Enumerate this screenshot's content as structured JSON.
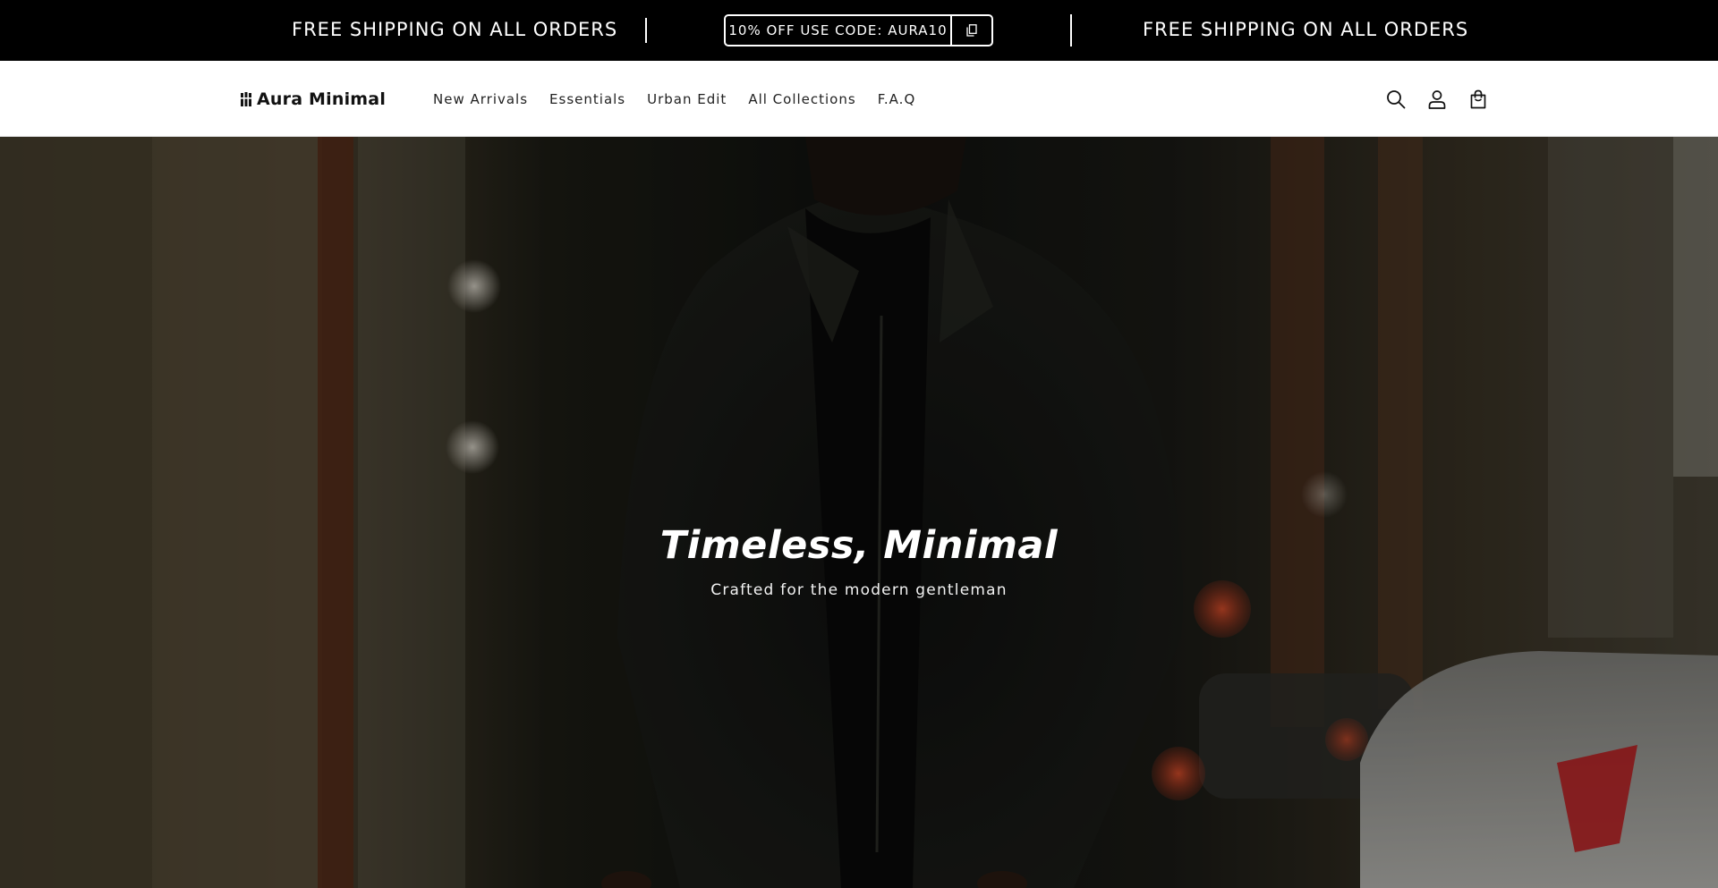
{
  "announcement": {
    "left_message": "FREE SHIPPING ON ALL ORDERS",
    "promo_code_text": "10% OFF USE CODE: AURA10",
    "right_message": "FREE SHIPPING ON ALL ORDERS",
    "copy_icon": "copy-icon"
  },
  "header": {
    "logo_text": "Aura Minimal",
    "nav": [
      {
        "label": "New Arrivals"
      },
      {
        "label": "Essentials"
      },
      {
        "label": "Urban Edit"
      },
      {
        "label": "All Collections"
      },
      {
        "label": "F.A.Q"
      }
    ],
    "icons": [
      "search-icon",
      "account-icon",
      "cart-icon"
    ]
  },
  "hero": {
    "title": "Timeless, Minimal",
    "subtitle": "Crafted for the modern gentleman"
  },
  "colors": {
    "announcement_bg": "#000000",
    "header_bg": "#ffffff",
    "text_dark": "#111111",
    "hero_text": "#ffffff"
  }
}
